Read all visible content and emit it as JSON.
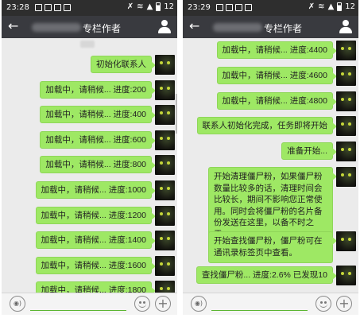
{
  "left": {
    "time": "23:28",
    "battery": "12",
    "title": "专栏作者",
    "messages": [
      "初始化联系人",
      "加载中，请稍候... 进度:200",
      "加载中，请稍候... 进度:400",
      "加载中，请稍候... 进度:600",
      "加载中，请稍候... 进度:800",
      "加载中，请稍候... 进度:1000",
      "加载中，请稍候... 进度:1200",
      "加载中，请稍候... 进度:1400",
      "加载中，请稍候... 进度:1600",
      "加载中，请稍候... 进度:1800"
    ]
  },
  "right": {
    "time": "23:29",
    "battery": "12",
    "title": "专栏作者",
    "messages": [
      "加载中，请稍候... 进度:4400",
      "加载中，请稍候... 进度:4600",
      "加载中，请稍候... 进度:4800",
      "联系人初始化完成，任务即将开始",
      "准备开始...",
      "开始清理僵尸粉，如果僵尸粉数量比较多的话，清理时间会比较长，期间不影响您正常使用。同时会将僵尸粉的名片备份发送在这里，以备不时之需。",
      "开始查找僵尸粉，僵尸粉可在通讯录标签页中查看。",
      "查找僵尸粉... 进度:2.6% 已发现10"
    ]
  },
  "icons": {
    "back": "back-arrow-icon",
    "contact": "contact-info-icon",
    "voice": "voice-icon",
    "emoji": "emoji-icon",
    "more": "plus-icon"
  },
  "colors": {
    "bubble": "#9ee864",
    "title_bar": "#393a3f",
    "status_bar": "#2e2e2e",
    "chat_bg": "#ebebeb"
  }
}
